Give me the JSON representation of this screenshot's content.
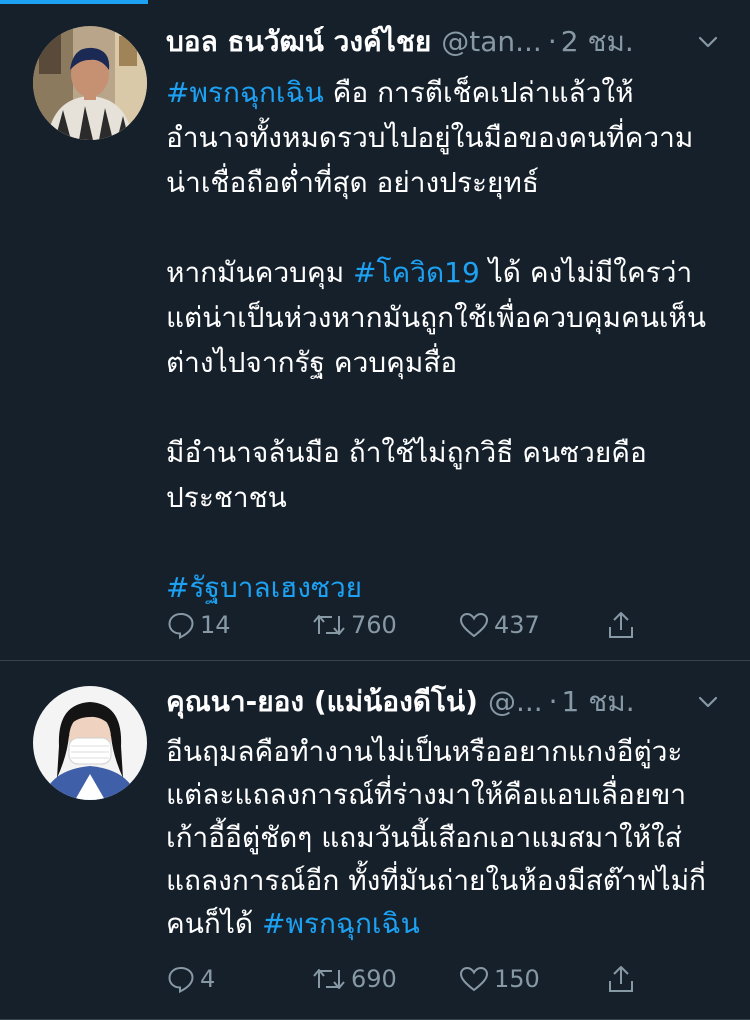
{
  "colors": {
    "background": "#15202b",
    "divider": "#38444d",
    "accent": "#1da1f2",
    "secondary_text": "#8899a6",
    "primary_text": "#ffffff"
  },
  "tweets": [
    {
      "display_name": "บอล ธนวัฒน์ วงค์ไชย",
      "handle": "@tan...",
      "separator": "·",
      "time": "2 ชม.",
      "caret_icon": "chevron-down-icon",
      "paragraphs": [
        [
          {
            "text": "#พรกฉุกเฉิน",
            "hashtag": true
          },
          {
            "text": " คือ การตีเช็คเปล่าแล้วให้อำนาจทั้งหมดรวบไปอยู่ในมือของคนที่ความน่าเชื่อถือต่ำที่สุด อย่างประยุทธ์",
            "hashtag": false
          }
        ],
        [
          {
            "text": "หากมันควบคุม ",
            "hashtag": false
          },
          {
            "text": "#โควิด19",
            "hashtag": true
          },
          {
            "text": " ได้ คงไม่มีใครว่า แต่น่าเป็นห่วงหากมันถูกใช้เพื่อควบคุมคนเห็นต่างไปจากรัฐ ควบคุมสื่อ",
            "hashtag": false
          }
        ],
        [
          {
            "text": "มีอำนาจล้นมือ ถ้าใช้ไม่ถูกวิธี คนซวยคือประชาชน",
            "hashtag": false
          }
        ],
        [
          {
            "text": "#รัฐบาลเฮงซวย",
            "hashtag": true
          }
        ]
      ],
      "actions": {
        "reply": "14",
        "retweet": "760",
        "like": "437",
        "share": ""
      }
    },
    {
      "display_name": "คุณนา-ยอง (แม่น้องดีโน่)",
      "handle": "@...",
      "separator": "·",
      "time": "1 ชม.",
      "caret_icon": "chevron-down-icon",
      "paragraphs": [
        [
          {
            "text": "อีนฤมลคือทำงานไม่เป็นหรืออยากแกงอีตู่วะ แต่ละแถลงการณ์ที่ร่างมาให้คือแอบเลื่อยขาเก้าอี้อีตู่ชัดๆ แถมวันนี้เสือกเอาแมสมาให้ใส่แถลงการณ์อีก ทั้งที่มันถ่ายในห้องมีสต๊าฟไม่กี่คนก็ได้ ",
            "hashtag": false
          },
          {
            "text": "#พรกฉุกเฉิน",
            "hashtag": true
          }
        ]
      ],
      "actions": {
        "reply": "4",
        "retweet": "690",
        "like": "150",
        "share": ""
      }
    }
  ]
}
